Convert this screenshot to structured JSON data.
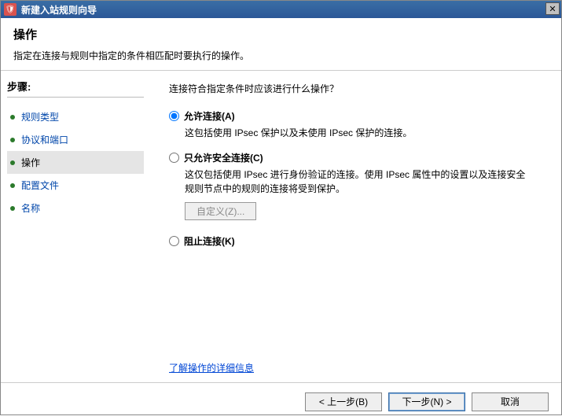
{
  "window": {
    "title": "新建入站规则向导"
  },
  "header": {
    "title": "操作",
    "subtitle": "指定在连接与规则中指定的条件相匹配时要执行的操作。"
  },
  "sidebar": {
    "steps_label": "步骤:",
    "items": [
      {
        "label": "规则类型"
      },
      {
        "label": "协议和端口"
      },
      {
        "label": "操作"
      },
      {
        "label": "配置文件"
      },
      {
        "label": "名称"
      }
    ]
  },
  "content": {
    "question": "连接符合指定条件时应该进行什么操作？",
    "options": [
      {
        "label": "允许连接(A)",
        "desc": "这包括使用 IPsec 保护以及未使用 IPsec 保护的连接。",
        "checked": true
      },
      {
        "label": "只允许安全连接(C)",
        "desc": "这仅包括使用 IPsec 进行身份验证的连接。使用 IPsec 属性中的设置以及连接安全规则节点中的规则的连接将受到保护。",
        "checked": false
      },
      {
        "label": "阻止连接(K)",
        "desc": "",
        "checked": false
      }
    ],
    "customize_button": "自定义(Z)...",
    "learn_more": "了解操作的详细信息"
  },
  "footer": {
    "back": "< 上一步(B)",
    "next": "下一步(N) >",
    "cancel": "取消"
  }
}
